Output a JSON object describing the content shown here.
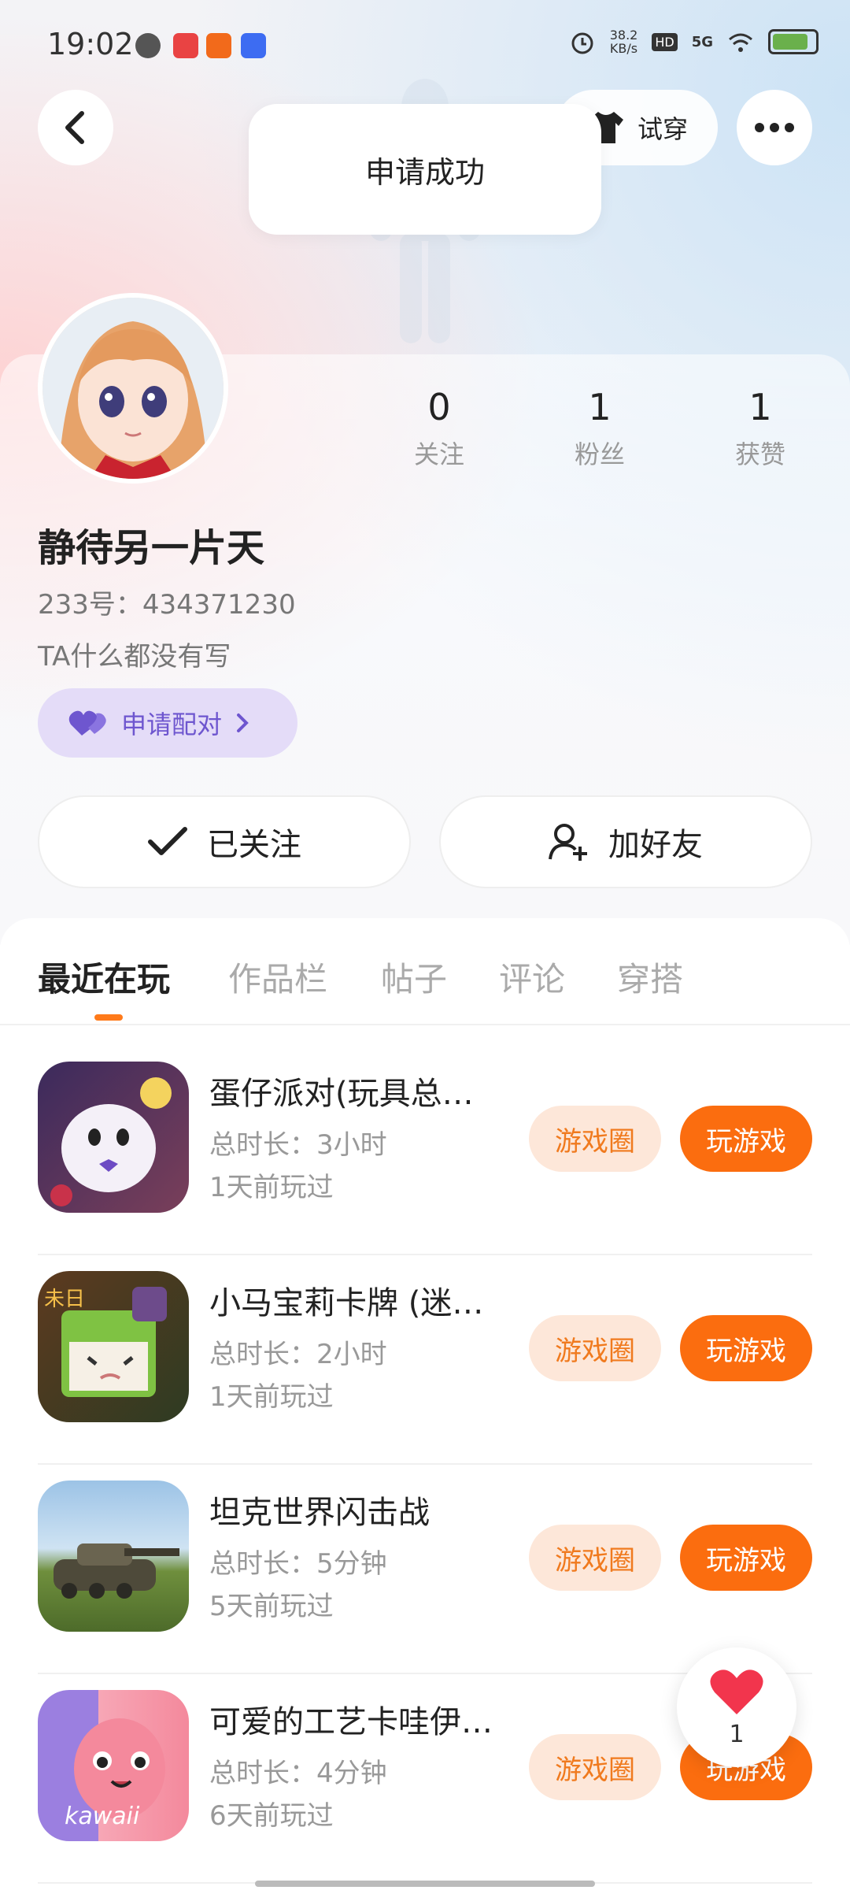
{
  "status_bar": {
    "time": "19:02",
    "speed_value": "38.2",
    "speed_unit": "KB/s",
    "hd": "HD",
    "network": "5G"
  },
  "header": {
    "tryon_label": "试穿",
    "toast": "申请成功"
  },
  "profile": {
    "stats": [
      {
        "value": "0",
        "label": "关注"
      },
      {
        "value": "1",
        "label": "粉丝"
      },
      {
        "value": "1",
        "label": "获赞"
      }
    ],
    "name": "静待另一片天",
    "uid": "233号：434371230",
    "bio": "TA什么都没有写",
    "pair_label": "申请配对",
    "followed_label": "已关注",
    "add_friend_label": "加好友"
  },
  "tabs": [
    "最近在玩",
    "作品栏",
    "帖子",
    "评论",
    "穿搭"
  ],
  "games": [
    {
      "title": "蛋仔派对(玩具总…",
      "duration": "总时长：3小时",
      "last_played": "1天前玩过",
      "circle_label": "游戏圈",
      "play_label": "玩游戏"
    },
    {
      "title": "小马宝莉卡牌 (迷…",
      "duration": "总时长：2小时",
      "last_played": "1天前玩过",
      "circle_label": "游戏圈",
      "play_label": "玩游戏"
    },
    {
      "title": "坦克世界闪击战",
      "duration": "总时长：5分钟",
      "last_played": "5天前玩过",
      "circle_label": "游戏圈",
      "play_label": "玩游戏"
    },
    {
      "title": "可爱的工艺卡哇伊…",
      "duration": "总时长：4分钟",
      "last_played": "6天前玩过",
      "circle_label": "游戏圈",
      "play_label": "玩游戏",
      "icon_text": "kawaii"
    }
  ],
  "like_float": {
    "count": "1"
  },
  "colors": {
    "accent": "#fb6d0f",
    "pair": "#6e56cf"
  }
}
